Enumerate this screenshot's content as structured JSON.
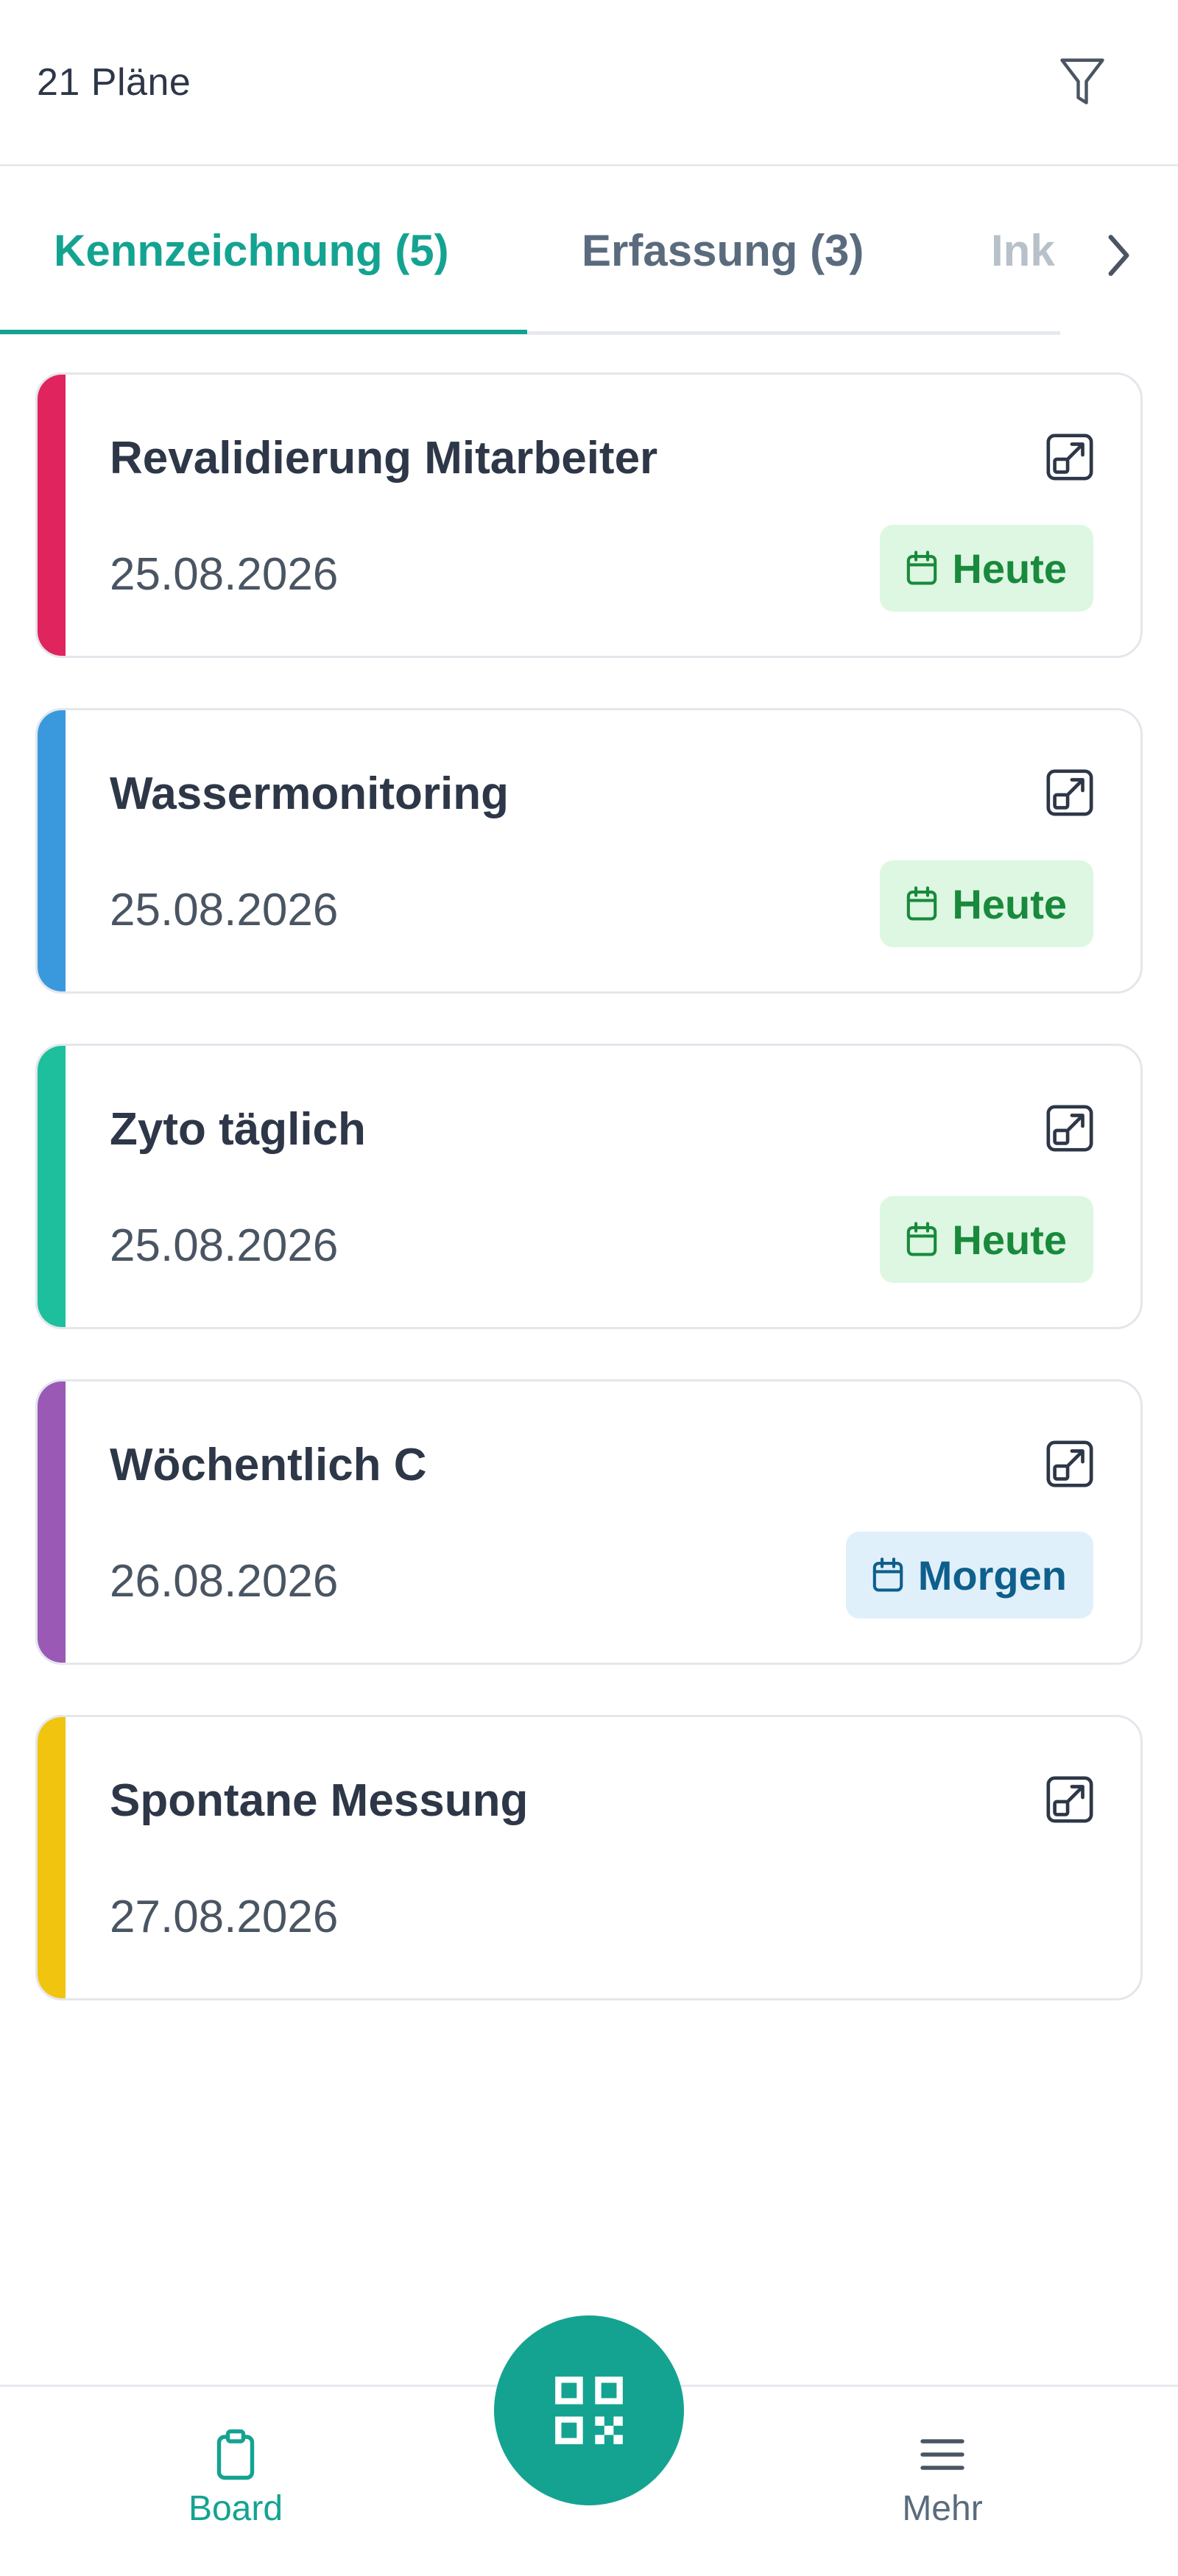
{
  "header": {
    "plan_count": "21 Pläne",
    "filter_icon": "filter-icon"
  },
  "tabs": [
    {
      "label": "Kennzeichnung (5)",
      "active": true
    },
    {
      "label": "Erfassung (3)",
      "active": false
    },
    {
      "label": "Ink",
      "active": false
    }
  ],
  "tab_next_icon": "chevron-right-icon",
  "cards": [
    {
      "title": "Revalidierung Mitarbeiter",
      "date": "25.08.2026",
      "badge": "Heute",
      "accent": "#e0245e"
    },
    {
      "title": "Wassermonitoring",
      "date": "25.08.2026",
      "badge": "Heute",
      "accent": "#3a99dd"
    },
    {
      "title": "Zyto täglich",
      "date": "25.08.2026",
      "badge": "Heute",
      "accent": "#1dbf9c"
    },
    {
      "title": "Wöchentlich C",
      "date": "26.08.2026",
      "badge": "Morgen",
      "accent": "#9b59b6"
    },
    {
      "title": "Spontane Messung",
      "date": "27.08.2026",
      "badge": "",
      "accent": "#f1c40f"
    }
  ],
  "bottom_nav": {
    "board_label": "Board",
    "more_label": "Mehr",
    "fab_icon": "qr-code-icon"
  },
  "colors": {
    "primary": "#14a391",
    "today_bg": "#ddf7e3",
    "today_text": "#198a3b",
    "tomorrow_bg": "#e0f0fb",
    "tomorrow_text": "#0f5f8c"
  }
}
